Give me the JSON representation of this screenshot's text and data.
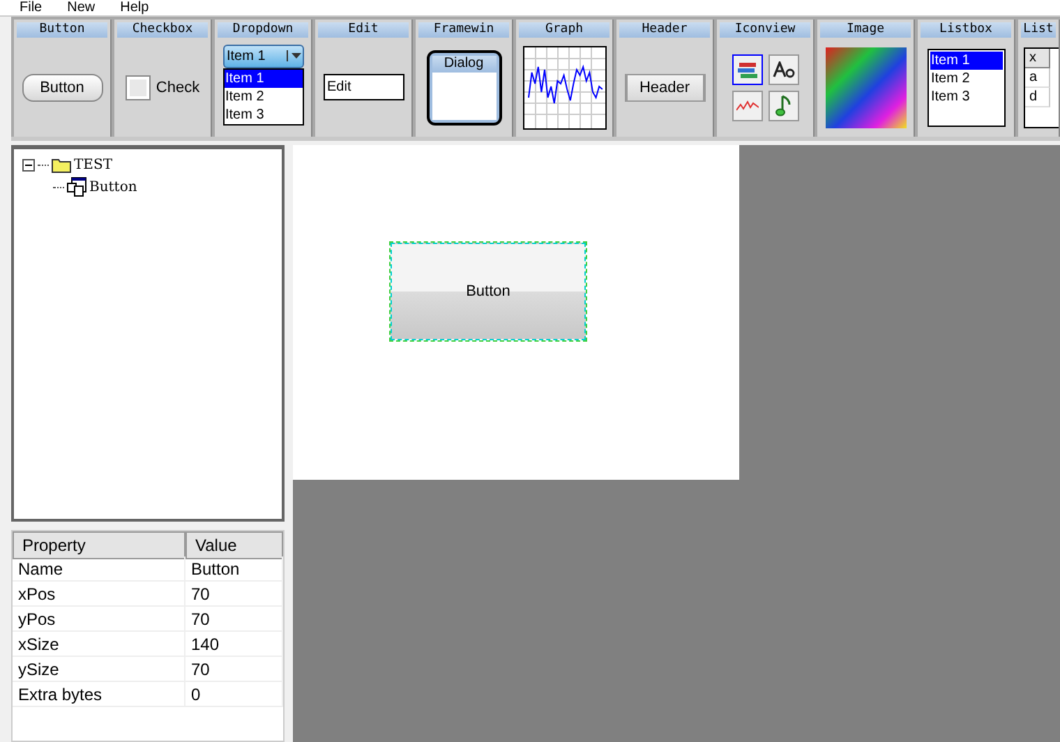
{
  "menu": [
    "File",
    "New",
    "Help"
  ],
  "palette": [
    {
      "label": "Button",
      "kind": "button",
      "text": "Button"
    },
    {
      "label": "Checkbox",
      "kind": "checkbox",
      "text": "Check",
      "checked": false
    },
    {
      "label": "Dropdown",
      "kind": "dropdown",
      "value": "Item 1",
      "items": [
        {
          "text": "Item 1",
          "selected": true
        },
        {
          "text": "Item 2",
          "selected": false
        },
        {
          "text": "Item 3",
          "selected": false
        }
      ]
    },
    {
      "label": "Edit",
      "kind": "edit",
      "value": "Edit"
    },
    {
      "label": "Framewin",
      "kind": "framewin",
      "title": "Dialog"
    },
    {
      "label": "Graph",
      "kind": "graph"
    },
    {
      "label": "Header",
      "kind": "header",
      "text": "Header"
    },
    {
      "label": "Iconview",
      "kind": "iconview",
      "icons": [
        {
          "selected": true
        },
        {
          "selected": false
        },
        {
          "selected": false
        },
        {
          "selected": false
        }
      ]
    },
    {
      "label": "Image",
      "kind": "image"
    },
    {
      "label": "Listbox",
      "kind": "listbox",
      "items": [
        {
          "text": "Item 1",
          "selected": true
        },
        {
          "text": "Item 2",
          "selected": false
        },
        {
          "text": "Item 3",
          "selected": false
        }
      ]
    },
    {
      "label": "List",
      "kind": "listview",
      "header": "x",
      "rows": [
        "a",
        "d"
      ]
    }
  ],
  "tree": [
    {
      "label": "TEST",
      "expanded": true,
      "children": [
        {
          "label": "Button"
        }
      ]
    }
  ],
  "canvas": {
    "button": {
      "text": "Button",
      "selected": true
    }
  },
  "properties": {
    "columns": [
      "Property",
      "Value"
    ],
    "rows": [
      {
        "name": "Name",
        "value": "Button"
      },
      {
        "name": "xPos",
        "value": "70"
      },
      {
        "name": "yPos",
        "value": "70"
      },
      {
        "name": "xSize",
        "value": "140"
      },
      {
        "name": "ySize",
        "value": "70"
      },
      {
        "name": "Extra bytes",
        "value": "0"
      }
    ]
  }
}
